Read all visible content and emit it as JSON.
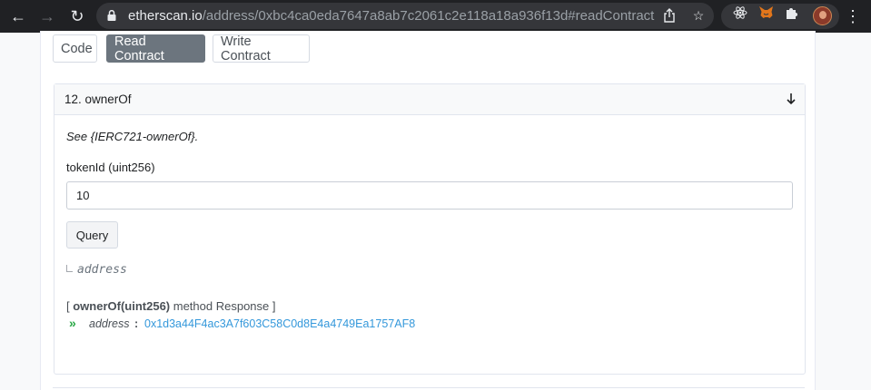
{
  "browser": {
    "url_host": "etherscan.io",
    "url_path": "/address/0xbc4ca0eda7647a8ab7c2061c2e118a18a936f13d#readContract"
  },
  "tabs": [
    {
      "label": "Code"
    },
    {
      "label": "Read Contract"
    },
    {
      "label": "Write Contract"
    }
  ],
  "function": {
    "title": "12. ownerOf",
    "description": "See {IERC721-ownerOf}.",
    "param_label": "tokenId (uint256)",
    "param_value": "10",
    "query_label": "Query",
    "return_type": "address"
  },
  "response": {
    "prefix": "[ ",
    "method": "ownerOf(uint256)",
    "suffix": " method Response ]",
    "key": "address",
    "colon": ":",
    "value": "0x1d3a44F4ac3A7f603C58C0d8E4a4749Ea1757AF8"
  },
  "colors": {
    "active_tab": "#6c757e",
    "link": "#3498db",
    "chevron": "#28a745"
  }
}
